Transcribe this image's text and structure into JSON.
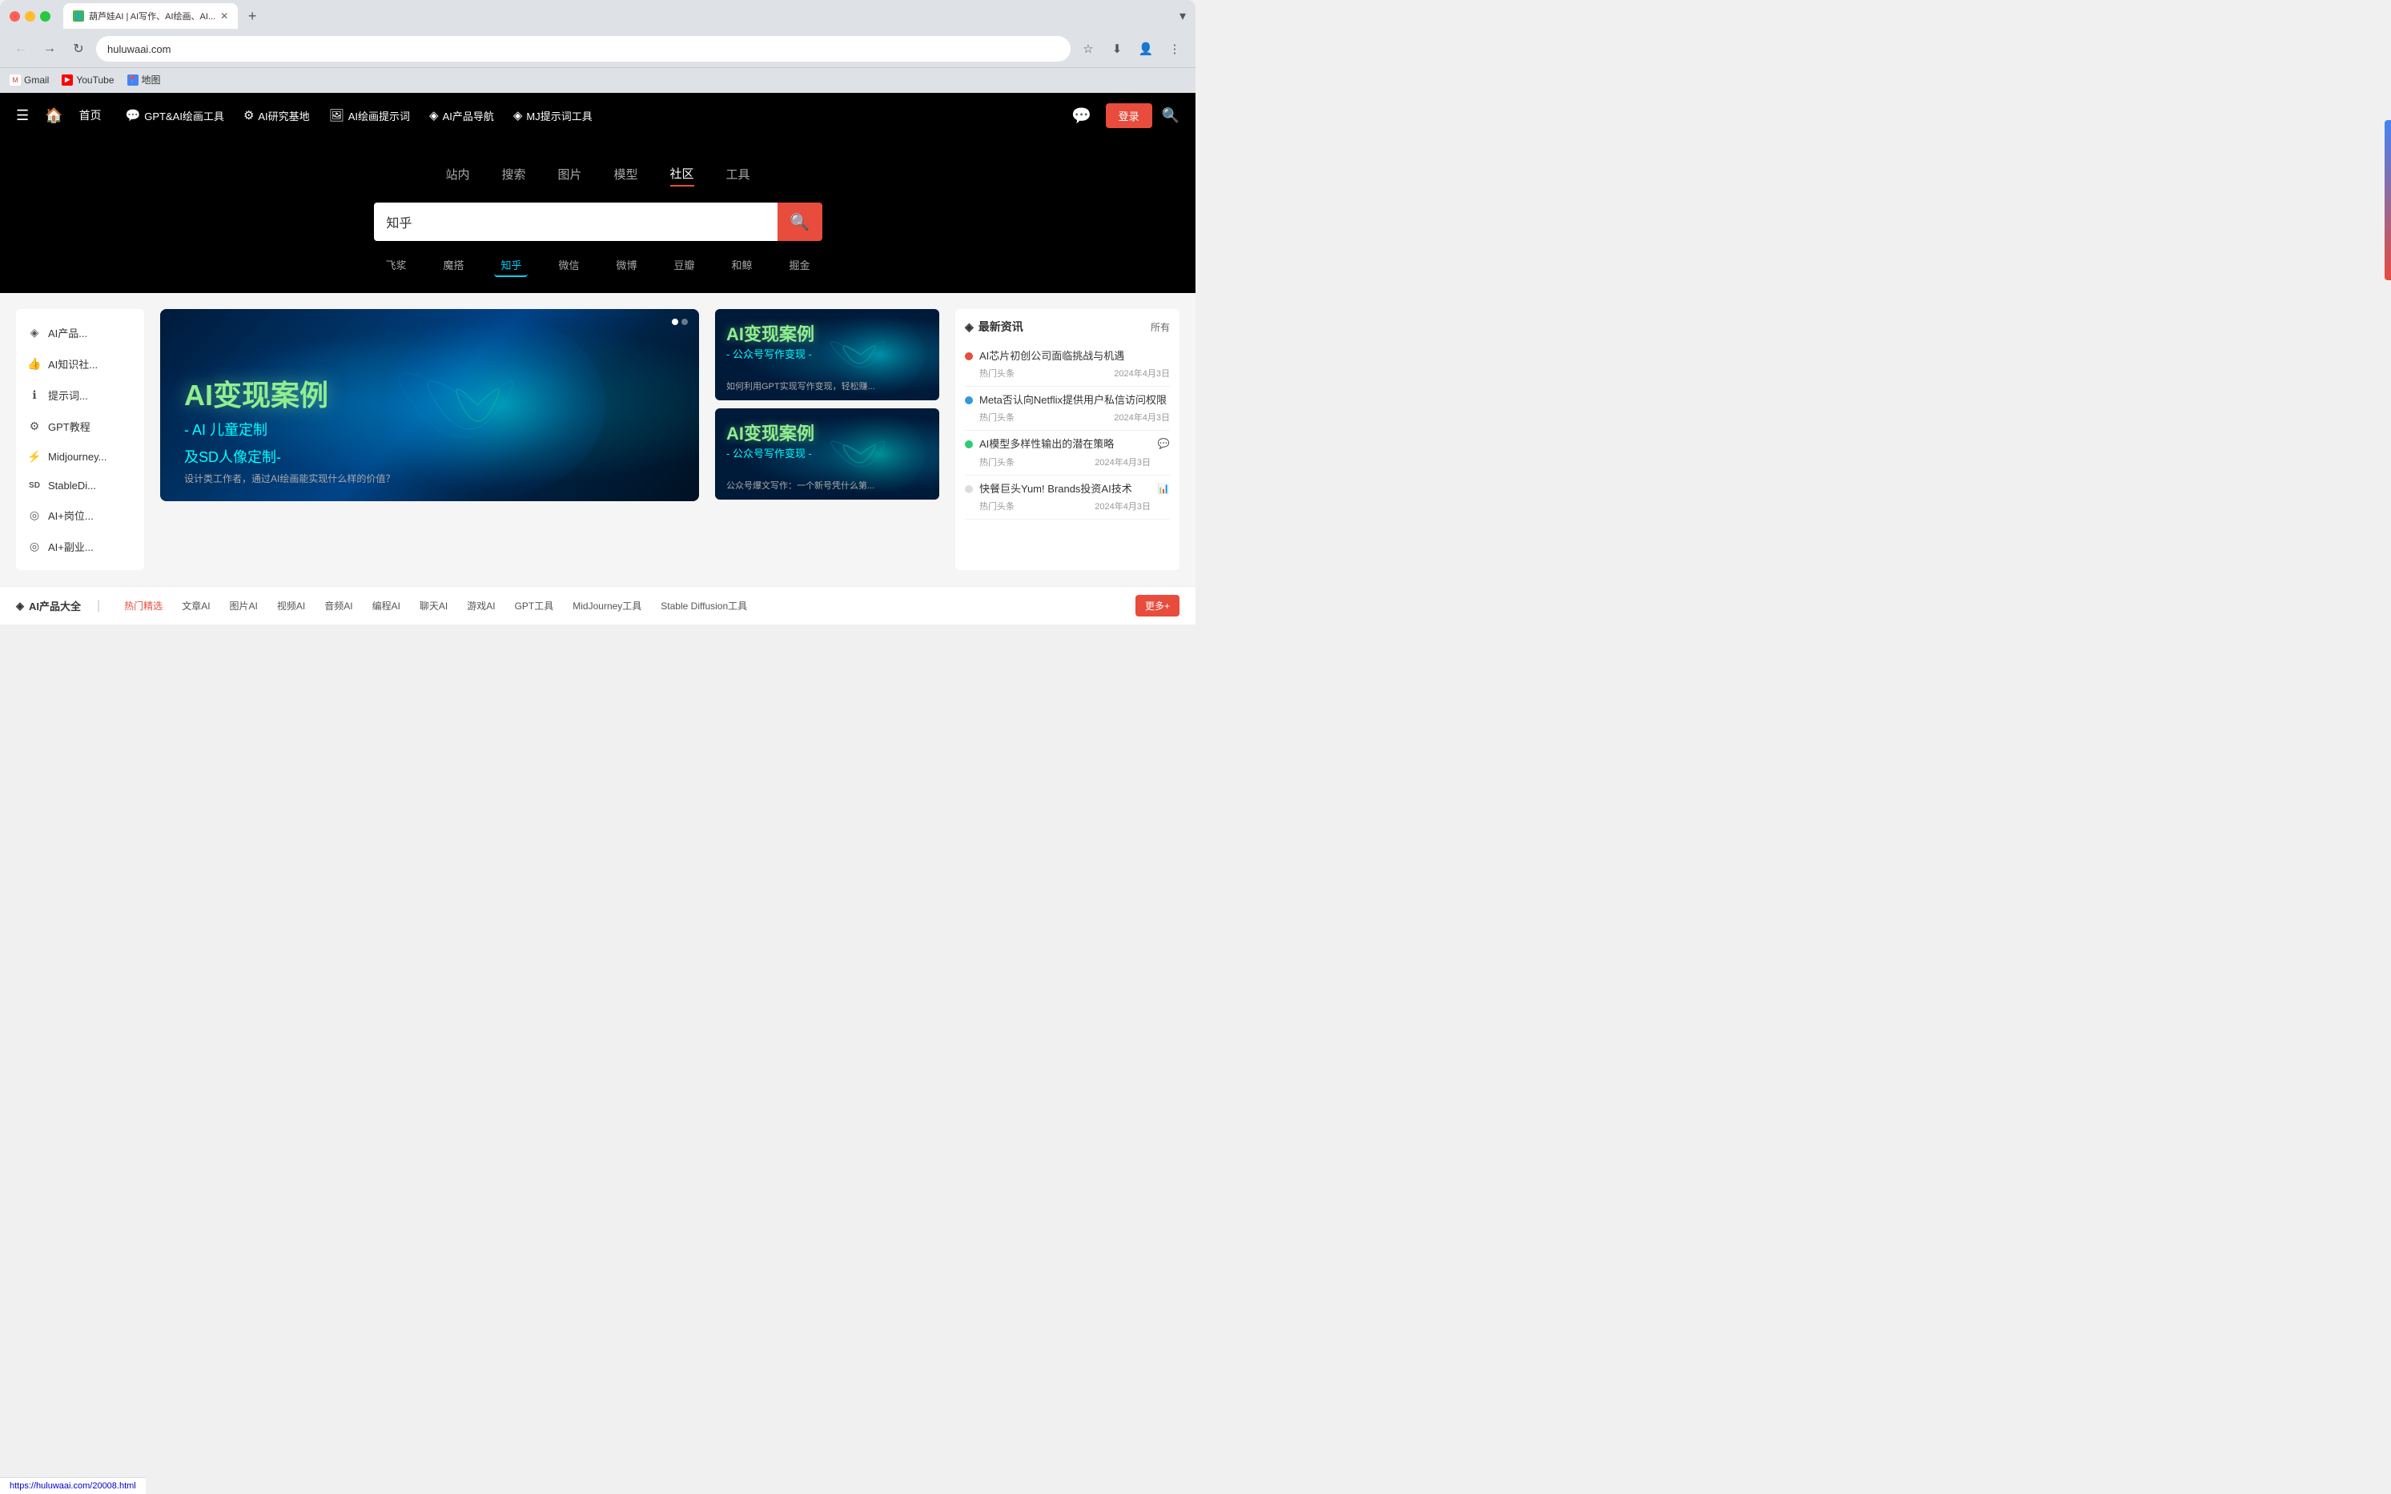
{
  "browser": {
    "tab_title": "葫芦娃AI | AI写作、AI绘画、AI...",
    "tab_favicon_text": "G",
    "url": "huluwaai.com",
    "new_tab_label": "+",
    "dropdown_label": "▾"
  },
  "bookmarks": [
    {
      "id": "gmail",
      "label": "Gmail",
      "icon": "M"
    },
    {
      "id": "youtube",
      "label": "YouTube",
      "icon": "▶"
    },
    {
      "id": "maps",
      "label": "地图",
      "icon": "📍"
    }
  ],
  "nav": {
    "hamburger": "☰",
    "home_icon": "🏠",
    "home_label": "首页",
    "items": [
      {
        "id": "gpt-ai",
        "icon": "💬",
        "label": "GPT&AI绘画工具"
      },
      {
        "id": "ai-research",
        "icon": "⚙",
        "label": "AI研究基地"
      },
      {
        "id": "ai-paint-prompt",
        "icon": "🖼",
        "label": "AI绘画提示词"
      },
      {
        "id": "ai-product-nav",
        "icon": "◈",
        "label": "AI产品导航"
      },
      {
        "id": "mj-prompt",
        "icon": "◈",
        "label": "MJ提示词工具"
      }
    ],
    "wechat_icon": "💬",
    "login_label": "登录",
    "search_icon": "🔍"
  },
  "hero": {
    "tabs": [
      {
        "id": "site",
        "label": "站内"
      },
      {
        "id": "search",
        "label": "搜索"
      },
      {
        "id": "image",
        "label": "图片"
      },
      {
        "id": "model",
        "label": "模型"
      },
      {
        "id": "community",
        "label": "社区",
        "active": true
      },
      {
        "id": "tools",
        "label": "工具"
      }
    ],
    "search_placeholder": "知乎",
    "search_value": "知乎",
    "search_icon": "🔍",
    "quick_links": [
      {
        "id": "feijing",
        "label": "飞浆"
      },
      {
        "id": "mota",
        "label": "魔搭"
      },
      {
        "id": "zhihu",
        "label": "知乎",
        "active": true
      },
      {
        "id": "weixin",
        "label": "微信"
      },
      {
        "id": "weibo",
        "label": "微博"
      },
      {
        "id": "douban",
        "label": "豆瓣"
      },
      {
        "id": "hexie",
        "label": "和鲸"
      },
      {
        "id": "juejin",
        "label": "掘金"
      }
    ]
  },
  "sidebar": {
    "items": [
      {
        "id": "ai-products",
        "icon": "◈",
        "label": "AI产品..."
      },
      {
        "id": "ai-knowledge",
        "icon": "👍",
        "label": "AI知识社..."
      },
      {
        "id": "prompt",
        "icon": "ℹ",
        "label": "提示词..."
      },
      {
        "id": "gpt-tutorial",
        "icon": "⚙",
        "label": "GPT教程"
      },
      {
        "id": "midjourney",
        "icon": "⚡",
        "label": "Midjourney..."
      },
      {
        "id": "stable-diff",
        "icon": "SD",
        "label": "StableDi..."
      },
      {
        "id": "ai-position",
        "icon": "◎",
        "label": "AI+岗位..."
      },
      {
        "id": "ai-sideline",
        "icon": "◎",
        "label": "AI+副业..."
      }
    ]
  },
  "banners": {
    "main": {
      "title": "AI变现案例",
      "subtitle": "- AI 儿童定制",
      "subtitle2": "及SD人像定制-",
      "desc": "设计类工作者，通过AI绘画能实现什么样的价值？"
    },
    "right": [
      {
        "id": "right-banner-1",
        "title": "AI变现案例",
        "subtitle": "- 公众号写作变现 -",
        "desc": "如何利用GPT实现写作变现，轻松赚..."
      },
      {
        "id": "right-banner-2",
        "title": "AI变现案例",
        "subtitle": "- 公众号写作变现 -",
        "desc": "公众号爆文写作：一个新号凭什么第..."
      }
    ]
  },
  "news": {
    "title": "最新资讯",
    "all_label": "所有",
    "items": [
      {
        "id": "news-1",
        "dot": "red",
        "text": "AI芯片初创公司面临挑战与机遇",
        "category": "热门头条",
        "date": "2024年4月3日",
        "platform_icon": ""
      },
      {
        "id": "news-2",
        "dot": "blue",
        "text": "Meta否认向Netflix提供用户私信访问权限",
        "category": "热门头条",
        "date": "2024年4月3日",
        "platform_icon": ""
      },
      {
        "id": "news-3",
        "dot": "green",
        "text": "AI模型多样性输出的潜在策略",
        "category": "热门头条",
        "date": "2024年4月3日",
        "platform_icon": "💬"
      },
      {
        "id": "news-4",
        "dot": "gray",
        "text": "快餐巨头Yum! Brands投资AI技术",
        "category": "热门头条",
        "date": "2024年4月3日",
        "platform_icon": "📊"
      }
    ]
  },
  "bottom_bar": {
    "logo_icon": "◈",
    "title": "AI产品大全",
    "divider": "|",
    "tabs": [
      {
        "id": "hot",
        "label": "热门精选",
        "active": true
      },
      {
        "id": "article",
        "label": "文章AI"
      },
      {
        "id": "image-ai",
        "label": "图片AI"
      },
      {
        "id": "video-ai",
        "label": "视频AI"
      },
      {
        "id": "audio-ai",
        "label": "音频AI"
      },
      {
        "id": "code-ai",
        "label": "编程AI"
      },
      {
        "id": "chat-ai",
        "label": "聊天AI"
      },
      {
        "id": "game-ai",
        "label": "游戏AI"
      },
      {
        "id": "gpt-tool",
        "label": "GPT工具"
      },
      {
        "id": "mj-tool",
        "label": "MidJourney工具"
      },
      {
        "id": "sd-tool",
        "label": "Stable Diffusion工具"
      }
    ],
    "more_label": "更多+"
  },
  "status_bar": {
    "url": "https://huluwaai.com/20008.html"
  },
  "colors": {
    "accent": "#e74c3c",
    "nav_bg": "#000000",
    "hero_bg": "#000000",
    "search_active": "#00d4ff"
  }
}
